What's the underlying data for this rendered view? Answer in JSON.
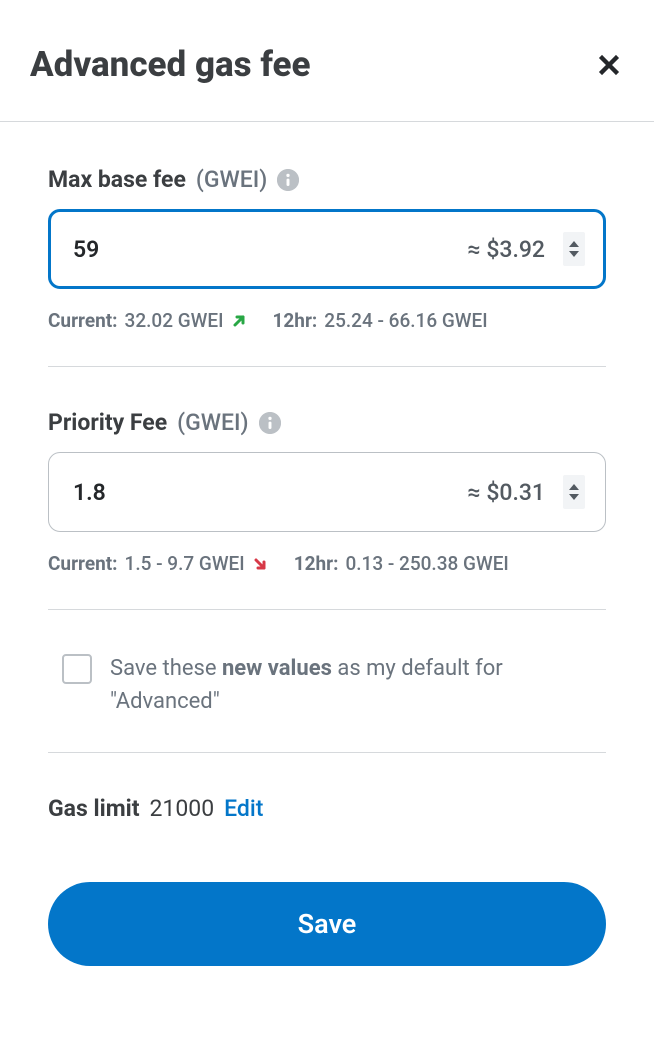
{
  "header": {
    "title": "Advanced gas fee"
  },
  "maxBaseFee": {
    "label": "Max base fee",
    "unit": "(GWEI)",
    "value": "59",
    "fiat": "≈ $3.92",
    "currentLabel": "Current:",
    "currentValue": "32.02 GWEI",
    "twelveHrLabel": "12hr:",
    "twelveHrValue": "25.24 - 66.16 GWEI"
  },
  "priorityFee": {
    "label": "Priority Fee",
    "unit": "(GWEI)",
    "value": "1.8",
    "fiat": "≈ $0.31",
    "currentLabel": "Current:",
    "currentValue": "1.5 - 9.7 GWEI",
    "twelveHrLabel": "12hr:",
    "twelveHrValue": "0.13 - 250.38 GWEI"
  },
  "checkbox": {
    "prefix": "Save these ",
    "bold": "new values",
    "suffix": " as my default for \"Advanced\""
  },
  "gasLimit": {
    "label": "Gas limit",
    "value": "21000",
    "editLabel": "Edit"
  },
  "saveButton": {
    "label": "Save"
  }
}
